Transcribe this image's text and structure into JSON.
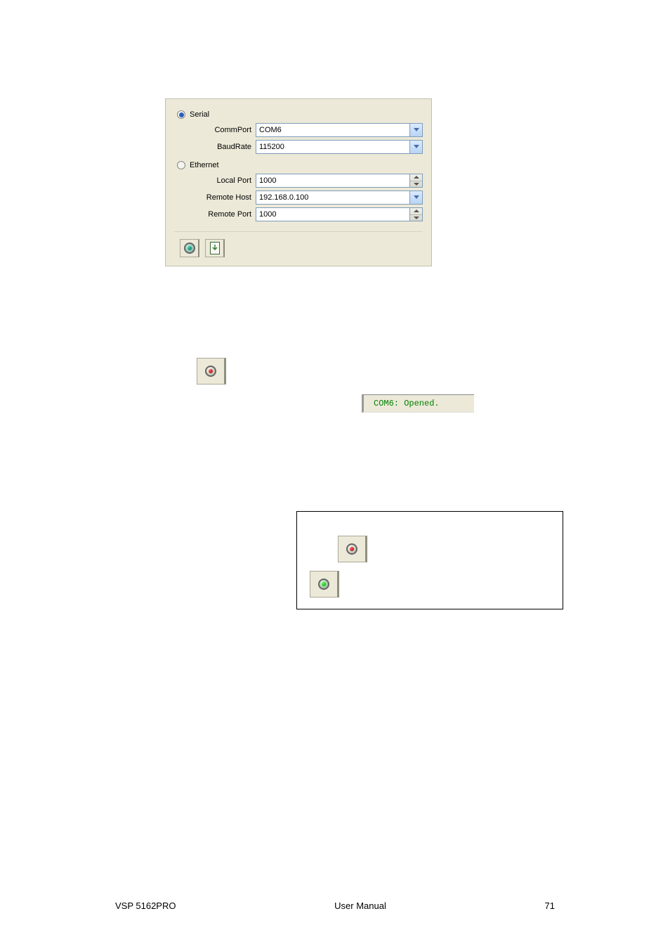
{
  "panel": {
    "serial_radio_label": "Serial",
    "serial_selected": true,
    "commport_label": "CommPort",
    "commport_value": "COM6",
    "baudrate_label": "BaudRate",
    "baudrate_value": "115200",
    "ethernet_radio_label": "Ethernet",
    "ethernet_selected": false,
    "localport_label": "Local Port",
    "localport_value": "1000",
    "remotehost_label": "Remote Host",
    "remotehost_value": "192.168.0.100",
    "remoteport_label": "Remote Port",
    "remoteport_value": "1000"
  },
  "status": {
    "opened_text": "COM6: Opened."
  },
  "footer": {
    "left": "VSP 5162PRO",
    "center": "User Manual",
    "right": "71"
  }
}
